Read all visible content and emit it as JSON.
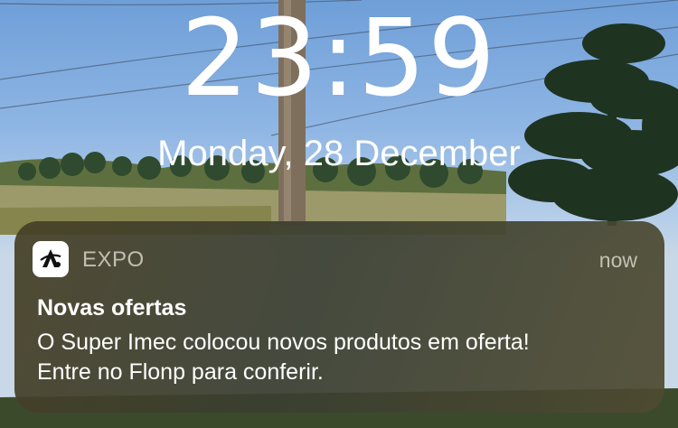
{
  "lock_screen": {
    "time": "23:59",
    "date": "Monday, 28 December"
  },
  "notification": {
    "app_icon": "expo-app-icon",
    "app_name": "EXPO",
    "time": "now",
    "title": "Novas ofertas",
    "body": "O Super Imec colocou novos produtos em oferta! Entre no Flonp para conferir."
  },
  "colors": {
    "notification_background": "#433f2c",
    "text_primary": "#ffffff",
    "text_secondary": "#c9c8bd",
    "sky": "#8fb6e4"
  }
}
